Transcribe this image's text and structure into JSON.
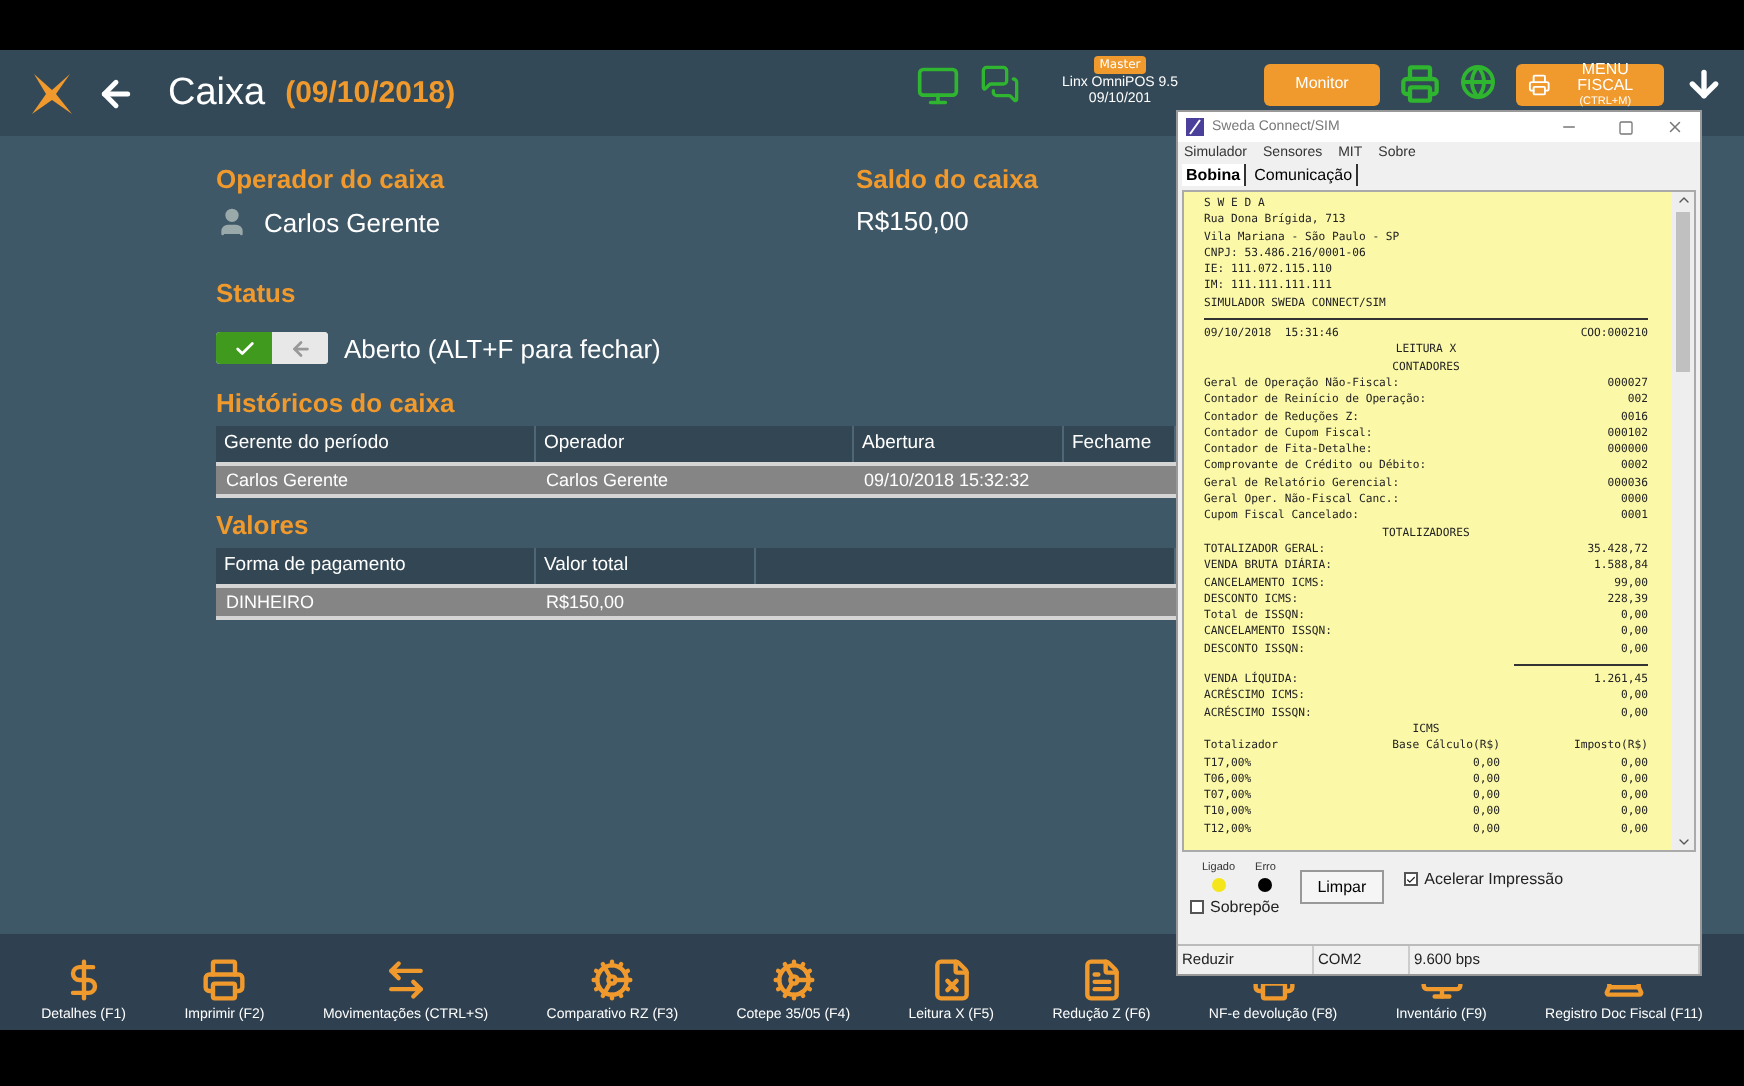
{
  "header": {
    "title": "Caixa",
    "date": "(09/10/2018)",
    "badge": "Master",
    "product": "Linx OmniPOS  9.5",
    "datetime": "09/10/201",
    "monitor_button": "Monitor",
    "fiscal_button": {
      "label": "MENU FISCAL",
      "shortcut": "(CTRL+M)"
    }
  },
  "operator": {
    "title": "Operador do caixa",
    "name": "Carlos Gerente"
  },
  "balance": {
    "title": "Saldo do caixa",
    "value": "R$150,00"
  },
  "status": {
    "title": "Status",
    "on": true,
    "label": "Aberto (ALT+F para fechar)"
  },
  "history": {
    "title": "Históricos do caixa",
    "columns": [
      "Gerente do período",
      "Operador",
      "Abertura",
      "Fechame"
    ],
    "rows": [
      {
        "cells": [
          "Carlos Gerente",
          "Carlos Gerente",
          "09/10/2018 15:32:32",
          ""
        ],
        "selected": true
      }
    ]
  },
  "values": {
    "title": "Valores",
    "columns": [
      "Forma de pagamento",
      "Valor total",
      ""
    ],
    "rows": [
      {
        "cells": [
          "DINHEIRO",
          "R$150,00",
          ""
        ],
        "selected": true
      }
    ]
  },
  "toolbar": [
    {
      "kind": "dollar",
      "label": "Detalhes (F1)"
    },
    {
      "kind": "printer",
      "label": "Imprimir (F2)"
    },
    {
      "kind": "arrows",
      "label": "Movimentações (CTRL+S)"
    },
    {
      "kind": "cogs",
      "label": "Comparativo RZ (F3)"
    },
    {
      "kind": "cogs",
      "label": "Cotepe 35/05 (F4)"
    },
    {
      "kind": "filex",
      "label": "Leitura X (F5)"
    },
    {
      "kind": "doc",
      "label": "Redução Z (F6)"
    },
    {
      "kind": "printer",
      "label": "NF-e devolução (F8)"
    },
    {
      "kind": "monitor",
      "label": "Inventário (F9)"
    },
    {
      "kind": "laptop",
      "label": "Registro Doc Fiscal (F11)"
    }
  ],
  "sim_window": {
    "title": "Sweda Connect/SIM",
    "menu": [
      "Simulador",
      "Sensores",
      "MIT",
      "Sobre"
    ],
    "tabs": [
      {
        "label": "Bobina",
        "selected": true
      },
      {
        "label": "Comunicação",
        "selected": false
      }
    ],
    "receipt": [
      {
        "kind": "text",
        "text": "S W E D A"
      },
      {
        "kind": "text",
        "text": "Rua Dona Brígida, 713"
      },
      {
        "kind": "text",
        "text": "Vila Mariana - São Paulo - SP"
      },
      {
        "kind": "text",
        "text": "CNPJ: 53.486.216/0001-06"
      },
      {
        "kind": "text",
        "text": "IE: 111.072.115.110"
      },
      {
        "kind": "text",
        "text": "IM: 111.111.111.111"
      },
      {
        "kind": "text",
        "text": "SIMULADOR SWEDA CONNECT/SIM"
      },
      {
        "kind": "rule"
      },
      {
        "kind": "pair",
        "text": "09/10/2018  15:31:46",
        "value": "COO:000210"
      },
      {
        "kind": "center",
        "text": "LEITURA X"
      },
      {
        "kind": "center",
        "text": "CONTADORES"
      },
      {
        "kind": "pair",
        "text": "Geral de Operação Não-Fiscal:",
        "value": "000027"
      },
      {
        "kind": "pair",
        "text": "Contador de Reinício de Operação:",
        "value": "002"
      },
      {
        "kind": "pair",
        "text": "Contador de Reduções Z:",
        "value": "0016"
      },
      {
        "kind": "pair",
        "text": "Contador de Cupom Fiscal:",
        "value": "000102"
      },
      {
        "kind": "pair",
        "text": "Contador de Fita-Detalhe:",
        "value": "000000"
      },
      {
        "kind": "pair",
        "text": "Comprovante de Crédito ou Débito:",
        "value": "0002"
      },
      {
        "kind": "pair",
        "text": "Geral de Relatório Gerencial:",
        "value": "000036"
      },
      {
        "kind": "pair",
        "text": "Geral Oper. Não-Fiscal Canc.:",
        "value": "0000"
      },
      {
        "kind": "pair",
        "text": "Cupom Fiscal Cancelado:",
        "value": "0001"
      },
      {
        "kind": "center",
        "text": "TOTALIZADORES"
      },
      {
        "kind": "pair",
        "text": "TOTALIZADOR GERAL:",
        "value": "35.428,72"
      },
      {
        "kind": "pair",
        "text": "VENDA BRUTA DIÁRIA:",
        "value": "1.588,84"
      },
      {
        "kind": "pair",
        "text": "CANCELAMENTO ICMS:",
        "value": "99,00"
      },
      {
        "kind": "pair",
        "text": "DESCONTO ICMS:",
        "value": "228,39"
      },
      {
        "kind": "pair",
        "text": "Total de ISSQN:",
        "value": "0,00"
      },
      {
        "kind": "pair",
        "text": "CANCELAMENTO ISSQN:",
        "value": "0,00"
      },
      {
        "kind": "pair",
        "text": "DESCONTO ISSQN:",
        "value": "0,00"
      },
      {
        "kind": "subrule"
      },
      {
        "kind": "pair",
        "text": "VENDA LÍQUIDA:",
        "value": "1.261,45"
      },
      {
        "kind": "pair",
        "text": "ACRÉSCIMO ICMS:",
        "value": "0,00"
      },
      {
        "kind": "pair",
        "text": "ACRÉSCIMO ISSQN:",
        "value": "0,00"
      },
      {
        "kind": "center",
        "text": "ICMS"
      },
      {
        "kind": "triple",
        "cells": [
          "Totalizador",
          "Base Cálculo(R$)",
          "Imposto(R$)"
        ]
      },
      {
        "kind": "triple",
        "cells": [
          "T17,00%",
          "0,00",
          "0,00"
        ]
      },
      {
        "kind": "triple",
        "cells": [
          "T06,00%",
          "0,00",
          "0,00"
        ]
      },
      {
        "kind": "triple",
        "cells": [
          "T07,00%",
          "0,00",
          "0,00"
        ]
      },
      {
        "kind": "triple",
        "cells": [
          "T10,00%",
          "0,00",
          "0,00"
        ]
      },
      {
        "kind": "triple",
        "cells": [
          "T12,00%",
          "0,00",
          "0,00"
        ]
      }
    ],
    "lights": [
      {
        "label": "Ligado",
        "color": "#f5e51b"
      },
      {
        "label": "Erro",
        "color": "#000000"
      }
    ],
    "clear_button": "Limpar",
    "checkboxes": [
      {
        "label": "Acelerar Impressão",
        "checked": true
      },
      {
        "label": "Sobrepõe",
        "checked": false
      }
    ],
    "status_bar": [
      "Reduzir",
      "COM2",
      "9.600 bps"
    ]
  }
}
